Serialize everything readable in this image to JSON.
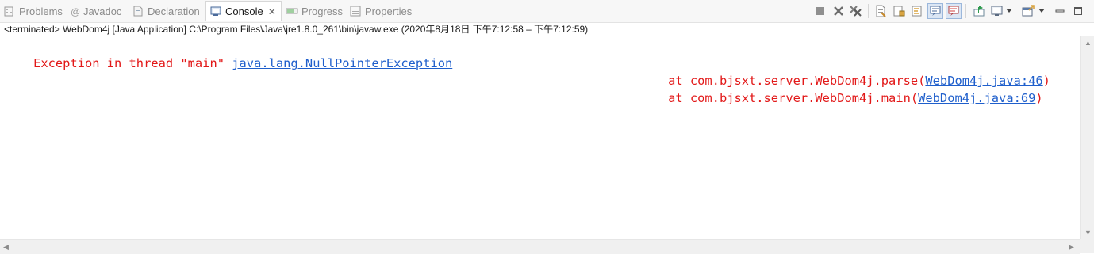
{
  "tabs": [
    {
      "label": "Problems",
      "icon": "problems-icon"
    },
    {
      "label": "Javadoc",
      "icon": "javadoc-icon"
    },
    {
      "label": "Declaration",
      "icon": "declaration-icon"
    },
    {
      "label": "Console",
      "icon": "console-icon",
      "active": true,
      "close": "✕"
    },
    {
      "label": "Progress",
      "icon": "progress-icon"
    },
    {
      "label": "Properties",
      "icon": "properties-icon"
    }
  ],
  "toolbar_icons": [
    "terminate-icon",
    "remove-launch-icon",
    "remove-all-terminated-icon",
    "clear-console-icon",
    "scroll-lock-icon",
    "word-wrap-icon",
    "show-on-stdout-icon",
    "show-on-stderr-icon",
    "pin-console-icon",
    "display-selected-console-icon",
    "open-console-icon",
    "minimize-icon",
    "maximize-icon"
  ],
  "status": "<terminated> WebDom4j [Java Application] C:\\Program Files\\Java\\jre1.8.0_261\\bin\\javaw.exe  (2020年8月18日 下午7:12:58 – 下午7:12:59)",
  "console": {
    "line1_prefix": "Exception in thread \"main\" ",
    "line1_link": "java.lang.NullPointerException",
    "line2_prefix": "at com.bjsxt.server.WebDom4j.parse(",
    "line2_link": "WebDom4j.java:46",
    "line2_suffix": ")",
    "line3_prefix": "at com.bjsxt.server.WebDom4j.main(",
    "line3_link": "WebDom4j.java:69",
    "line3_suffix": ")"
  },
  "colors": {
    "error_text": "#e21818",
    "link": "#1f5fcc",
    "active_tab_bg": "#ffffff",
    "tabbar_bg": "#f7f7f7"
  }
}
